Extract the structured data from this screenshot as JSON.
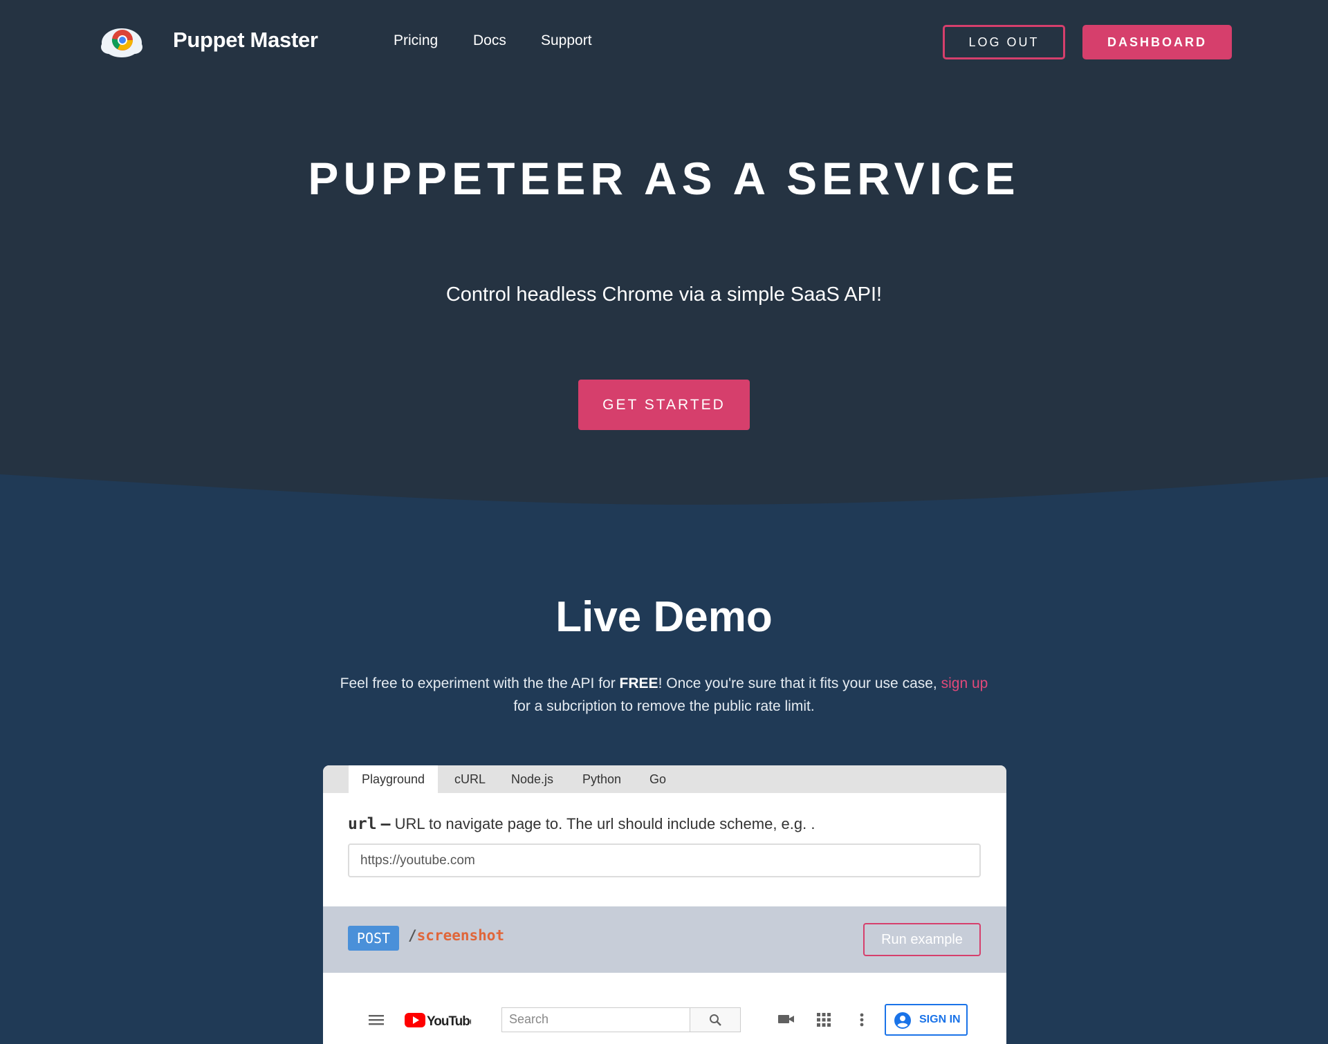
{
  "header": {
    "brand": "Puppet Master",
    "nav": [
      {
        "label": "Pricing"
      },
      {
        "label": "Docs"
      },
      {
        "label": "Support"
      }
    ],
    "logout_label": "LOG OUT",
    "dashboard_label": "DASHBOARD"
  },
  "hero": {
    "title": "PUPPETEER AS A SERVICE",
    "subtitle": "Control headless Chrome via a simple SaaS API!",
    "cta_label": "GET STARTED"
  },
  "demo": {
    "title": "Live Demo",
    "text_1": "Feel free to experiment with the the API for ",
    "text_free": "FREE",
    "text_2": "! Once you're sure that it fits your use case, ",
    "text_signup": "sign up",
    "text_3": " for a subcription to remove the public rate limit.",
    "tabs": [
      "Playground",
      "cURL",
      "Node.js",
      "Python",
      "Go"
    ],
    "param_name": "url",
    "param_sep": "–",
    "param_desc": "URL to navigate page to. The url should include scheme, e.g. .",
    "url_value": "https://youtube.com",
    "method": "POST",
    "path_slash": "/",
    "path_endpoint": "screenshot",
    "run_label": "Run example"
  },
  "preview": {
    "logo_text": "YouTube",
    "search_placeholder": "Search",
    "sign_in_label": "SIGN IN"
  },
  "colors": {
    "background": "#253342",
    "wave": "#203a56",
    "accent": "#d63f6c",
    "method": "#4a90d9",
    "endpoint": "#e0663a"
  }
}
